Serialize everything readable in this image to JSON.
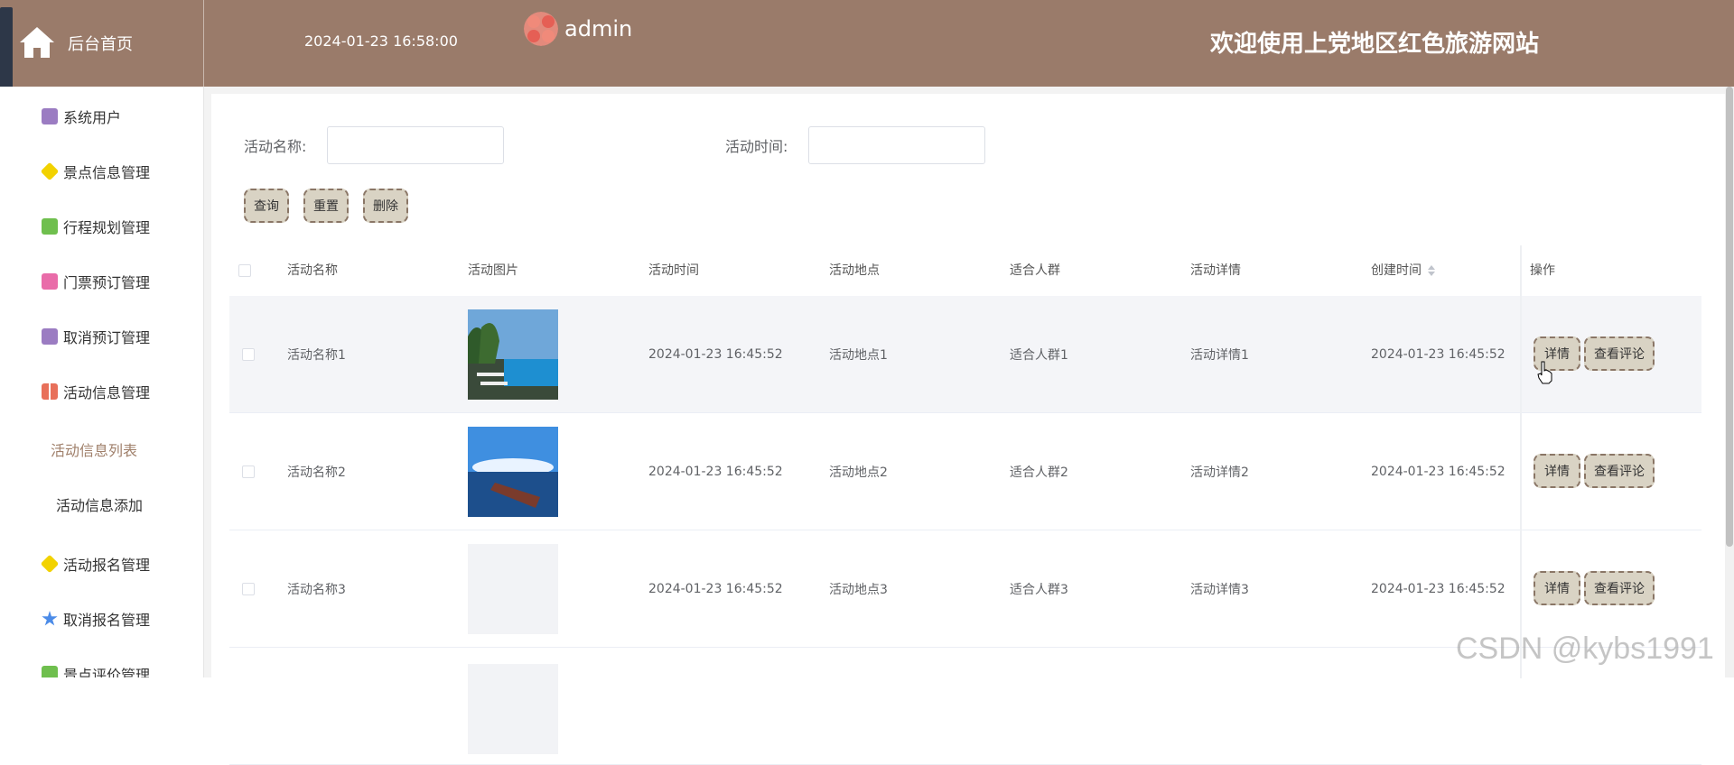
{
  "header": {
    "home_title": "后台首页",
    "datetime": "2024-01-23 16:58:00",
    "user": "admin",
    "welcome": "欢迎使用上党地区红色旅游网站",
    "bg_color": "#9a7b6a"
  },
  "sidebar": {
    "items": [
      {
        "label": "系统用户",
        "icon": "archive-icon",
        "color": "#9b7cc2"
      },
      {
        "label": "景点信息管理",
        "icon": "cube-icon",
        "color": "#f2d200"
      },
      {
        "label": "行程规划管理",
        "icon": "chat-icon",
        "color": "#6fbf4e"
      },
      {
        "label": "门票预订管理",
        "icon": "ticket-icon",
        "color": "#e96ca9"
      },
      {
        "label": "取消预订管理",
        "icon": "archive-icon",
        "color": "#9b7cc2"
      },
      {
        "label": "活动信息管理",
        "icon": "grid-icon",
        "color": "#e8705a"
      },
      {
        "label": "活动报名管理",
        "icon": "cube-icon",
        "color": "#f2d200"
      },
      {
        "label": "取消报名管理",
        "icon": "star-icon",
        "color": "#4b8be8"
      },
      {
        "label": "景点评价管理",
        "icon": "chat-icon",
        "color": "#6fbf4e"
      }
    ],
    "sub_items": [
      {
        "label": "活动信息列表",
        "active": true
      },
      {
        "label": "活动信息添加",
        "active": false
      }
    ]
  },
  "search": {
    "name_label": "活动名称:",
    "time_label": "活动时间:",
    "name_value": "",
    "time_value": "",
    "query_btn": "查询",
    "reset_btn": "重置",
    "delete_btn": "删除"
  },
  "table": {
    "headers": [
      "活动名称",
      "活动图片",
      "活动时间",
      "活动地点",
      "适合人群",
      "活动详情",
      "创建时间",
      "操作"
    ],
    "rows": [
      {
        "name": "活动名称1",
        "time": "2024-01-23 16:45:52",
        "place": "活动地点1",
        "crowd": "适合人群1",
        "detail": "活动详情1",
        "created": "2024-01-23 16:45:52",
        "image": "resort-pool"
      },
      {
        "name": "活动名称2",
        "time": "2024-01-23 16:45:52",
        "place": "活动地点2",
        "crowd": "适合人群2",
        "detail": "活动详情2",
        "created": "2024-01-23 16:45:52",
        "image": "sea-boat"
      },
      {
        "name": "活动名称3",
        "time": "2024-01-23 16:45:52",
        "place": "活动地点3",
        "crowd": "适合人群3",
        "detail": "活动详情3",
        "created": "2024-01-23 16:45:52",
        "image": "blank"
      }
    ],
    "detail_btn": "详情",
    "comment_btn": "查看评论"
  },
  "watermark": "CSDN @kybs1991"
}
